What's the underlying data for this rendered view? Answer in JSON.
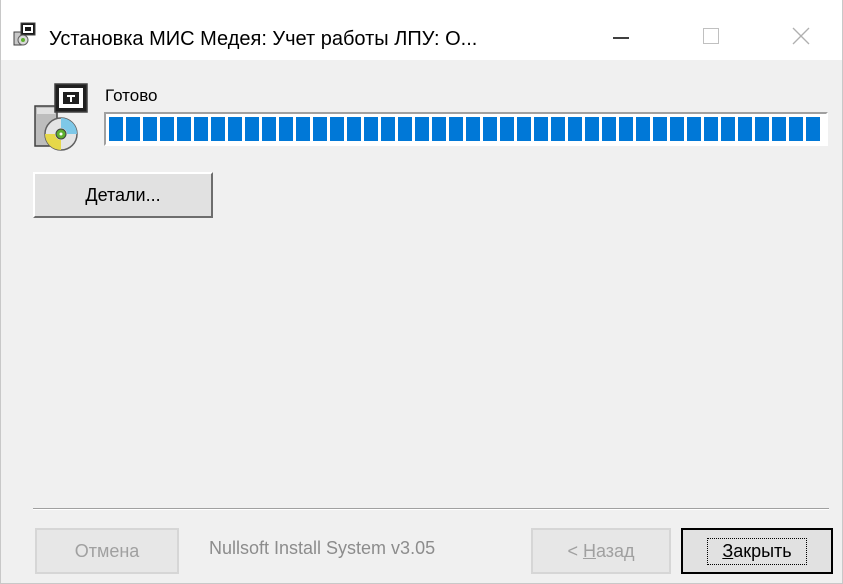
{
  "window": {
    "title": "Установка МИС Медея: Учет работы ЛПУ: О..."
  },
  "status": {
    "text": "Готово",
    "progress_percent": 100
  },
  "buttons": {
    "details": {
      "accel": "Д",
      "rest": "етали..."
    },
    "cancel": "Отмена",
    "back": {
      "prefix": "< ",
      "accel": "Н",
      "rest": "азад"
    },
    "close": {
      "accel": "З",
      "rest": "акрыть"
    }
  },
  "branding": "Nullsoft Install System v3.05",
  "colors": {
    "progress": "#0078d7",
    "background": "#f0f0f0"
  },
  "icons": {
    "title": "installer-icon",
    "main": "installer-disk-icon",
    "minimize": "minimize-icon",
    "maximize": "maximize-icon",
    "close": "close-icon"
  }
}
